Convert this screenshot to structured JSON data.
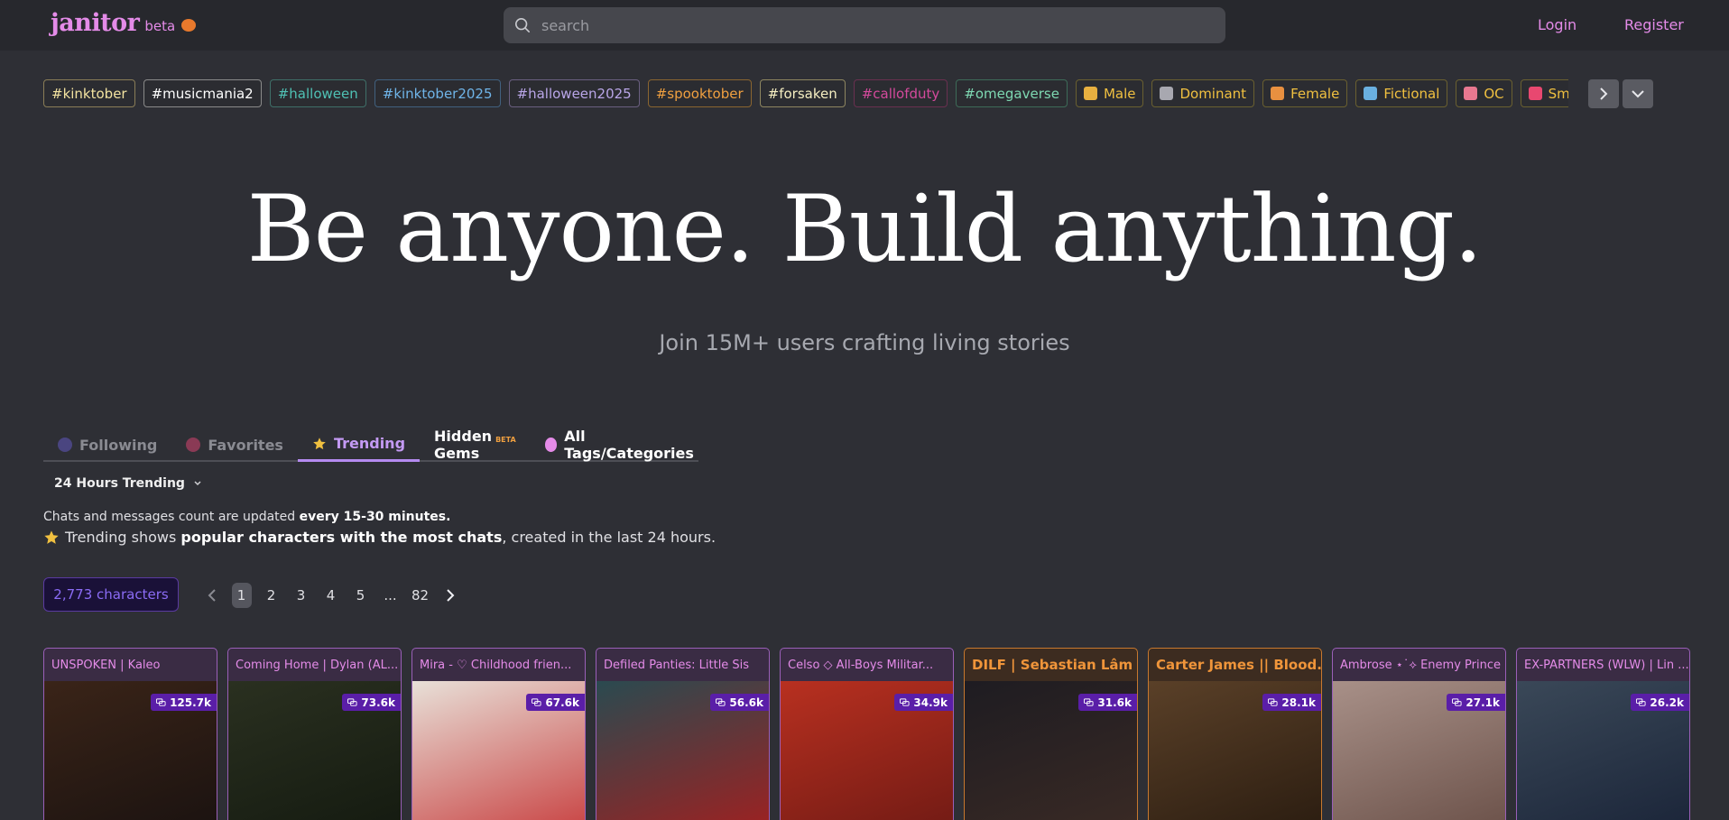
{
  "header": {
    "logo_text": "janitor",
    "beta_label": "beta",
    "search_placeholder": "search",
    "login_label": "Login",
    "register_label": "Register"
  },
  "tags": [
    {
      "label": "#kinktober",
      "color": "#f2e2a0",
      "border": "#8a7d57"
    },
    {
      "label": "#musicmania2",
      "color": "#ffffff",
      "border": "#8a8a8a"
    },
    {
      "label": "#halloween",
      "color": "#4fc1b4",
      "border": "#3f6f68"
    },
    {
      "label": "#kinktober2025",
      "color": "#6fb4e8",
      "border": "#41617f"
    },
    {
      "label": "#halloween2025",
      "color": "#b9a6e8",
      "border": "#6a5f80"
    },
    {
      "label": "#spooktober",
      "color": "#f0a040",
      "border": "#8a6530"
    },
    {
      "label": "#forsaken",
      "color": "#f6efc2",
      "border": "#8e8660"
    },
    {
      "label": "#callofduty",
      "color": "#d44a9c",
      "border": "#6a3050"
    },
    {
      "label": "#omegaverse",
      "color": "#7ed8b2",
      "border": "#3d6b58"
    },
    {
      "label": "Male",
      "color": "#f0c040",
      "border": "#6a6030",
      "icon": "male-face-icon",
      "icon_color": "#e8b040"
    },
    {
      "label": "Dominant",
      "color": "#f0c040",
      "border": "#6a6030",
      "icon": "chains-icon",
      "icon_color": "#a8a8b0"
    },
    {
      "label": "Female",
      "color": "#f0c040",
      "border": "#6a6030",
      "icon": "female-face-icon",
      "icon_color": "#e89040"
    },
    {
      "label": "Fictional",
      "color": "#f0c040",
      "border": "#6a6030",
      "icon": "books-icon",
      "icon_color": "#6ab0e0"
    },
    {
      "label": "OC",
      "color": "#f0c040",
      "border": "#6a6030",
      "icon": "artist-icon",
      "icon_color": "#e87890"
    },
    {
      "label": "Smut",
      "color": "#f0c040",
      "border": "#6a6030",
      "icon": "heart-icon",
      "icon_color": "#e84870"
    },
    {
      "label": "",
      "color": "#f0c040",
      "border": "#6a6030",
      "icon": "partial-tag-icon",
      "icon_color": "#7a5a3a"
    }
  ],
  "hero": {
    "title": "Be anyone. Build anything.",
    "subtitle": "Join 15M+ users crafting living stories"
  },
  "tabs": [
    {
      "label": "Following",
      "icon": "following-icon",
      "color": "#8a8b92",
      "icon_color": "#4a4580",
      "active": false
    },
    {
      "label": "Favorites",
      "icon": "heart-icon",
      "color": "#8a8b92",
      "icon_color": "#8a3a55",
      "active": false
    },
    {
      "label": "Trending",
      "icon": "star-icon",
      "color": "#c49af4",
      "icon_color": "#f0c040",
      "active": true
    },
    {
      "label": "Hidden Gems",
      "icon": "",
      "color": "#ffffff",
      "beta": "BETA",
      "active": false
    },
    {
      "label": "All Tags/Categories",
      "icon": "tags-icon",
      "color": "#ffffff",
      "icon_color": "#e48be8",
      "active": false
    }
  ],
  "filter": {
    "dropdown_label": "24 Hours Trending"
  },
  "info": {
    "line1_prefix": "Chats and messages count are updated ",
    "line1_bold": "every 15-30 minutes.",
    "line2_prefix": "Trending shows ",
    "line2_bold": "popular characters with the most chats",
    "line2_suffix": ", created in the last 24 hours."
  },
  "pagination": {
    "count_number": "2,773",
    "count_label": "characters",
    "pages": [
      "1",
      "2",
      "3",
      "4",
      "5",
      "...",
      "82"
    ],
    "current": "1"
  },
  "cards": [
    {
      "title": "UNSPOKEN | Kaleo",
      "stat": "125.7k",
      "style": "purple",
      "img_top": "#3a2418",
      "img_bot": "#1a1210"
    },
    {
      "title": "Coming Home | Dylan (AL...",
      "stat": "73.6k",
      "style": "purple",
      "img_top": "#2a3020",
      "img_bot": "#141a10"
    },
    {
      "title": "Mira - ♡ Childhood frien...",
      "stat": "67.6k",
      "style": "purple",
      "img_top": "#e8e0d8",
      "img_bot": "#c84040"
    },
    {
      "title": "Defiled Panties: Little Sis",
      "stat": "56.6k",
      "style": "purple",
      "img_top": "#2a4a50",
      "img_bot": "#a02020"
    },
    {
      "title": "Celso ◇ All-Boys Militar...",
      "stat": "34.9k",
      "style": "purple",
      "img_top": "#b83020",
      "img_bot": "#701a14"
    },
    {
      "title": "DILF | Sebastian Lâm",
      "stat": "31.6k",
      "style": "orange",
      "img_top": "#1e1c22",
      "img_bot": "#3a2a24"
    },
    {
      "title": "Carter James || Blood...",
      "stat": "28.1k",
      "style": "orange",
      "img_top": "#5a4028",
      "img_bot": "#2a1c10"
    },
    {
      "title": "Ambrose ⋆˙⟡ Enemy Prince",
      "stat": "27.1k",
      "style": "purple",
      "img_top": "#a89088",
      "img_bot": "#6a5048"
    },
    {
      "title": "EX-PARTNERS (WLW) | Lin ...",
      "stat": "26.2k",
      "style": "purple",
      "img_top": "#3a4858",
      "img_bot": "#1a2438"
    }
  ]
}
